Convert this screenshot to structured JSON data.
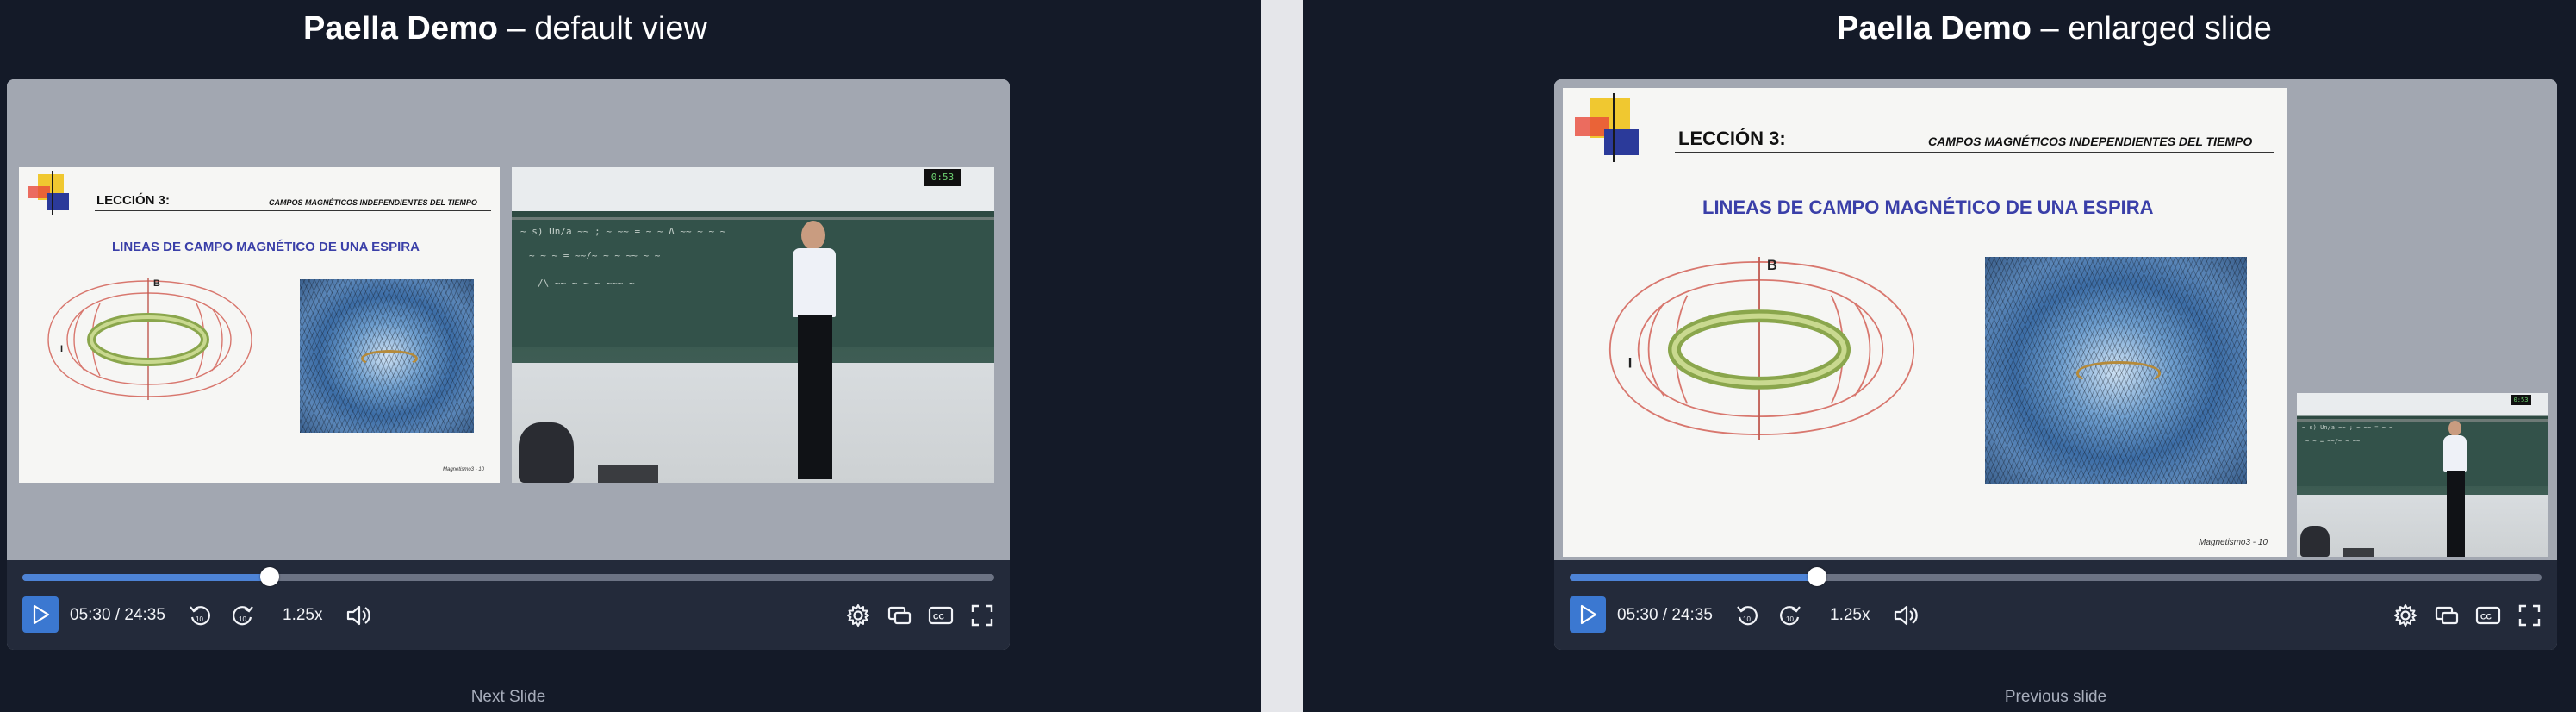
{
  "left_panel": {
    "title_bold": "Paella Demo",
    "title_rest": " – default view",
    "below_label": "Next Slide",
    "player": {
      "time": "05:30 / 24:35",
      "rate": "1.25x",
      "progress": 0.254
    }
  },
  "right_panel": {
    "title_bold": "Paella Demo",
    "title_rest": " – enlarged slide",
    "below_label": "Previous slide",
    "player": {
      "time": "05:30 / 24:35",
      "rate": "1.25x",
      "progress": 0.254
    }
  },
  "slide": {
    "lesson": "LECCIÓN 3:",
    "header": "CAMPOS MAGNÉTICOS INDEPENDIENTES DEL TIEMPO",
    "subtitle": "LINEAS DE CAMPO MAGNÉTICO DE UNA ESPIRA",
    "field_label": "B",
    "current_label": "I",
    "footer": "Magnetismo3 - 10"
  },
  "video": {
    "clock": "0:53"
  },
  "icons": {
    "play": "play-icon",
    "rewind": "rewind-10-icon",
    "forward": "forward-10-icon",
    "volume": "volume-icon",
    "settings": "gear-icon",
    "layout": "layout-switch-icon",
    "captions": "captions-icon",
    "fullscreen": "fullscreen-icon"
  },
  "colors": {
    "background": "#141a28",
    "player_stage": "#a2a7b1",
    "controls_bar": "#232a3a",
    "accent": "#3b78d1",
    "divider": "#e5e6ea"
  }
}
